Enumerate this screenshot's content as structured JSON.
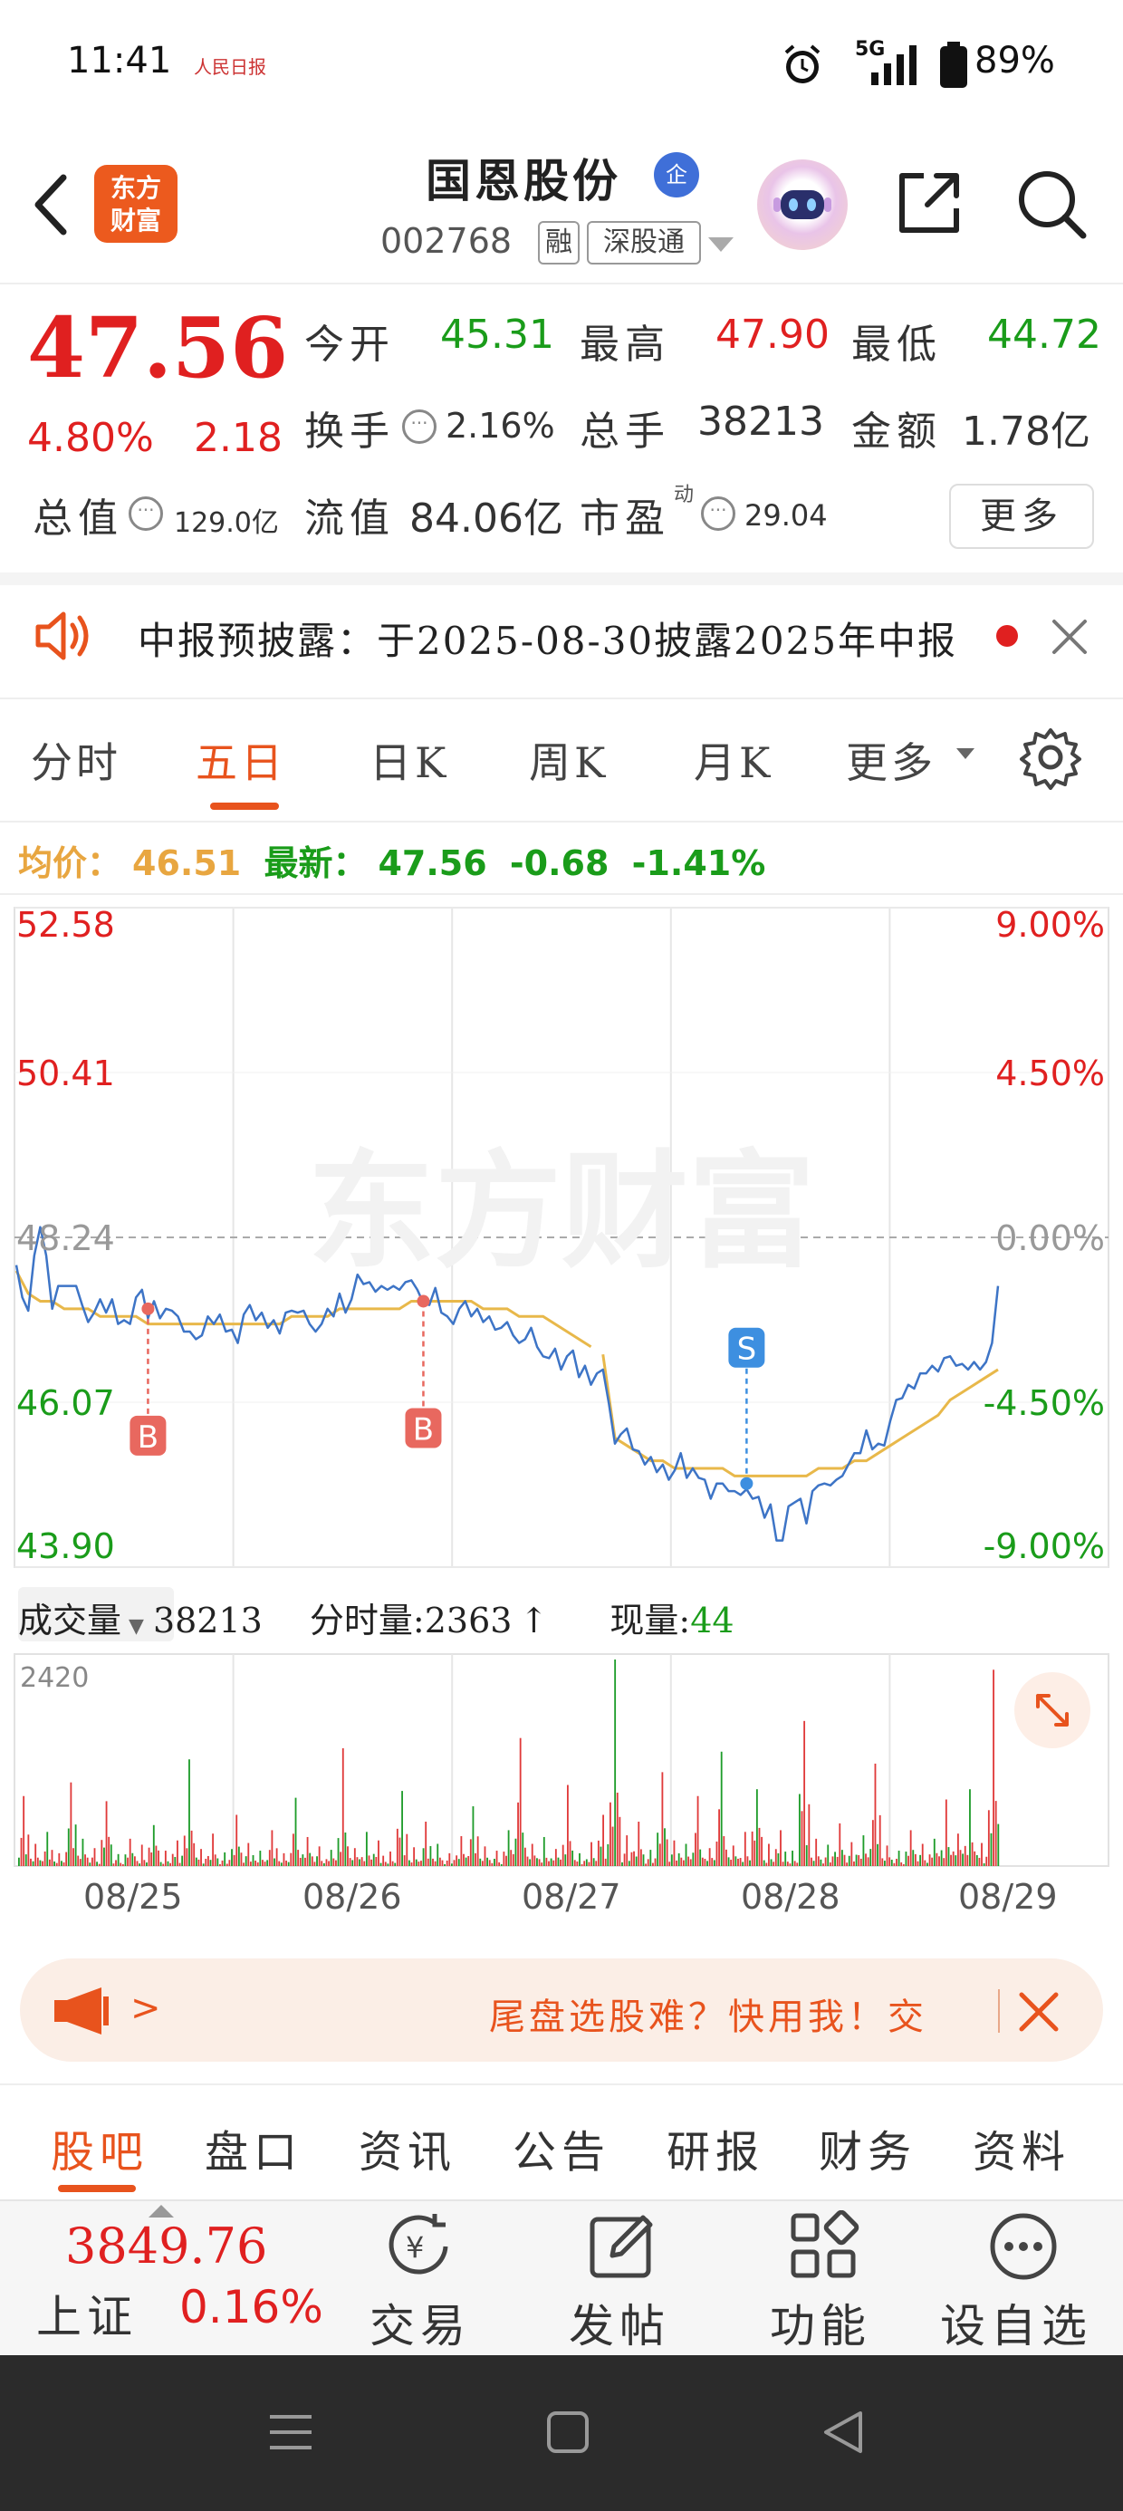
{
  "status_bar": {
    "time": "11:41",
    "app_badge": "人民日报",
    "network": "5G",
    "battery": "89%"
  },
  "header": {
    "logo_line1": "东方",
    "logo_line2": "财富",
    "stock_name": "国恩股份",
    "badge": "企",
    "stock_code": "002768",
    "tag_margin": "融",
    "tag_connect": "深股通"
  },
  "quote": {
    "price": "47.56",
    "change_pct": "4.80%",
    "change_abs": "2.18",
    "open_label": "今开",
    "open_value": "45.31",
    "high_label": "最高",
    "high_value": "47.90",
    "low_label": "最低",
    "low_value": "44.72",
    "turnover_label": "换手",
    "turnover_value": "2.16%",
    "volume_label": "总手",
    "volume_value": "38213",
    "amount_label": "金额",
    "amount_value": "1.78亿",
    "mktcap_label": "总值",
    "mktcap_value": "129.0亿",
    "float_label": "流值",
    "float_value": "84.06亿",
    "pe_label": "市盈",
    "pe_sup": "动",
    "pe_value": "29.04",
    "more_label": "更多"
  },
  "notice": {
    "text": "中报预披露：于2025-08-30披露2025年中报"
  },
  "chart_tabs": {
    "items": [
      "分时",
      "五日",
      "日K",
      "周K",
      "月K",
      "更多"
    ],
    "active": "五日"
  },
  "legend": {
    "avg_label": "均价：",
    "avg_value": "46.51",
    "latest_label": "最新：",
    "latest_value": "47.56",
    "latest_change": "-0.68",
    "latest_pct": "-1.41%"
  },
  "chart_data": {
    "type": "line",
    "title": "",
    "x": [
      "08/25",
      "08/26",
      "08/27",
      "08/28",
      "08/29"
    ],
    "ylim": [
      43.9,
      52.58
    ],
    "y_ticks_left": [
      "52.58",
      "50.41",
      "48.24",
      "46.07",
      "43.90"
    ],
    "y_ticks_right": [
      "9.00%",
      "4.50%",
      "0.00%",
      "-4.50%",
      "-9.00%"
    ],
    "reference_price": 48.24,
    "series": [
      {
        "name": "最新",
        "color": "#3d74c6",
        "values": [
          48.0,
          47.3,
          48.3,
          47.4,
          47.6,
          47.5,
          47.2,
          47.4,
          47.3,
          47.2,
          47.4,
          47.3,
          47.2,
          47.2,
          47.1,
          46.9,
          47.1,
          47.3,
          47.0,
          47.1,
          47.2,
          47.0,
          47.1,
          47.3,
          47.2,
          47.1,
          47.3,
          47.4,
          47.5,
          47.6,
          47.4,
          47.6,
          47.5,
          47.8,
          47.4,
          47.5,
          47.3,
          47.3,
          47.1,
          47.2,
          47.0,
          47.0,
          46.9,
          47.0,
          46.8,
          46.8,
          46.6,
          46.5,
          46.3,
          46.4,
          45.6,
          45.7,
          45.3,
          45.4,
          45.2,
          45.3,
          45.1,
          45.0,
          44.9,
          45.0,
          44.8,
          45.0,
          44.8,
          44.6,
          44.3,
          44.7,
          44.6,
          45.0,
          44.9,
          45.2,
          45.4,
          45.6,
          45.6,
          45.8,
          46.0,
          46.3,
          46.4,
          46.6,
          46.7,
          46.5,
          46.7,
          46.6,
          47.5
        ]
      },
      {
        "name": "均价",
        "color": "#e8b84a",
        "values": [
          47.8,
          47.5,
          47.4,
          47.4,
          47.3,
          47.3,
          47.3,
          47.2,
          47.2,
          47.2,
          47.2,
          47.1,
          47.1,
          47.1,
          47.1,
          47.1,
          47.1,
          47.1,
          47.1,
          47.1,
          47.1,
          47.1,
          47.1,
          47.2,
          47.2,
          47.2,
          47.2,
          47.3,
          47.3,
          47.3,
          47.3,
          47.3,
          47.3,
          47.4,
          47.4,
          47.4,
          47.4,
          47.4,
          47.4,
          47.3,
          47.3,
          47.3,
          47.2,
          47.2,
          47.2,
          47.1,
          47.0,
          46.9,
          46.8,
          46.7,
          45.6,
          45.5,
          45.4,
          45.3,
          45.3,
          45.2,
          45.2,
          45.2,
          45.2,
          45.2,
          45.1,
          45.1,
          45.1,
          45.1,
          45.1,
          45.1,
          45.1,
          45.2,
          45.2,
          45.2,
          45.3,
          45.3,
          45.4,
          45.5,
          45.6,
          45.7,
          45.8,
          45.9,
          46.1,
          46.2,
          46.3,
          46.4,
          46.5
        ]
      }
    ],
    "avg_line_breaks": [
      49
    ],
    "markers": [
      {
        "label": "B",
        "index": 11,
        "color": "#e8685f",
        "position": "below"
      },
      {
        "label": "B",
        "index": 34,
        "color": "#e8685f",
        "position": "below"
      },
      {
        "label": "S",
        "index": 61,
        "color": "#3d8fe0",
        "position": "above"
      }
    ],
    "volume": {
      "max_label": "2420",
      "ylim": [
        0,
        2420
      ],
      "values": [
        820,
        260,
        400,
        150,
        980,
        320,
        210,
        760,
        140,
        320,
        250,
        480,
        180,
        300,
        1250,
        200,
        380,
        160,
        600,
        270,
        180,
        420,
        150,
        800,
        340,
        230,
        190,
        1380,
        210,
        400,
        300,
        170,
        880,
        220,
        520,
        260,
        150,
        350,
        700,
        230,
        180,
        420,
        1500,
        260,
        340,
        200,
        950,
        150,
        280,
        600,
        2420,
        360,
        520,
        190,
        1100,
        300,
        260,
        820,
        210,
        1340,
        240,
        400,
        900,
        260,
        420,
        180,
        1700,
        320,
        250,
        500,
        280,
        360,
        1200,
        240,
        180,
        420,
        260,
        320,
        780,
        380,
        900,
        270,
        2300
      ],
      "colors": "alternating red #e03a3a / green #1e9c2a"
    }
  },
  "volume_header": {
    "selector_label": "成交量",
    "total": "38213",
    "tick_label": "分时量:",
    "tick_value": "2363",
    "now_label": "现量:",
    "now_value": "44"
  },
  "dates": [
    "08/25",
    "08/26",
    "08/27",
    "08/28",
    "08/29"
  ],
  "promo": {
    "text": "尾盘选股难？快用我！交"
  },
  "content_tabs": {
    "items": [
      "股吧",
      "盘口",
      "资讯",
      "公告",
      "研报",
      "财务",
      "资料"
    ],
    "active": "股吧"
  },
  "bottom_bar": {
    "index_value": "3849.76",
    "index_name": "上证",
    "index_change": "0.16%",
    "trade_label": "交易",
    "post_label": "发帖",
    "func_label": "功能",
    "watch_label": "设自选"
  },
  "colors": {
    "accent": "#e8531d",
    "up": "#e02020",
    "down": "#1a9c1a",
    "price_line": "#3d74c6",
    "avg_line": "#e8b84a"
  }
}
